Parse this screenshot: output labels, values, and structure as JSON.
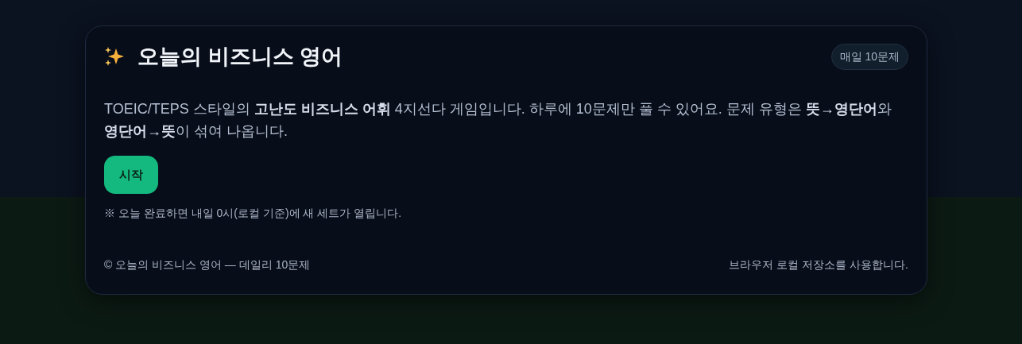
{
  "header": {
    "title": "오늘의 비즈니스 영어",
    "badge": "매일 10문제"
  },
  "intro": "TOEIC/TEPS 스타일의 **고난도 비즈니스 어휘** 4지선다 게임입니다. 하루에 10문제만 풀 수 있어요. 문제 유형은 **뜻→영단어**와 **영단어→뜻**이 섞여 나옵니다.",
  "start_button": "시작",
  "note": "※ 오늘 완료하면 내일 0시(로컬 기준)에 새 세트가 열립니다.",
  "footer": {
    "left": "© 오늘의 비즈니스 영어 — 데일리 10문제",
    "right": "브라우저 로컬 저장소를 사용합니다."
  }
}
